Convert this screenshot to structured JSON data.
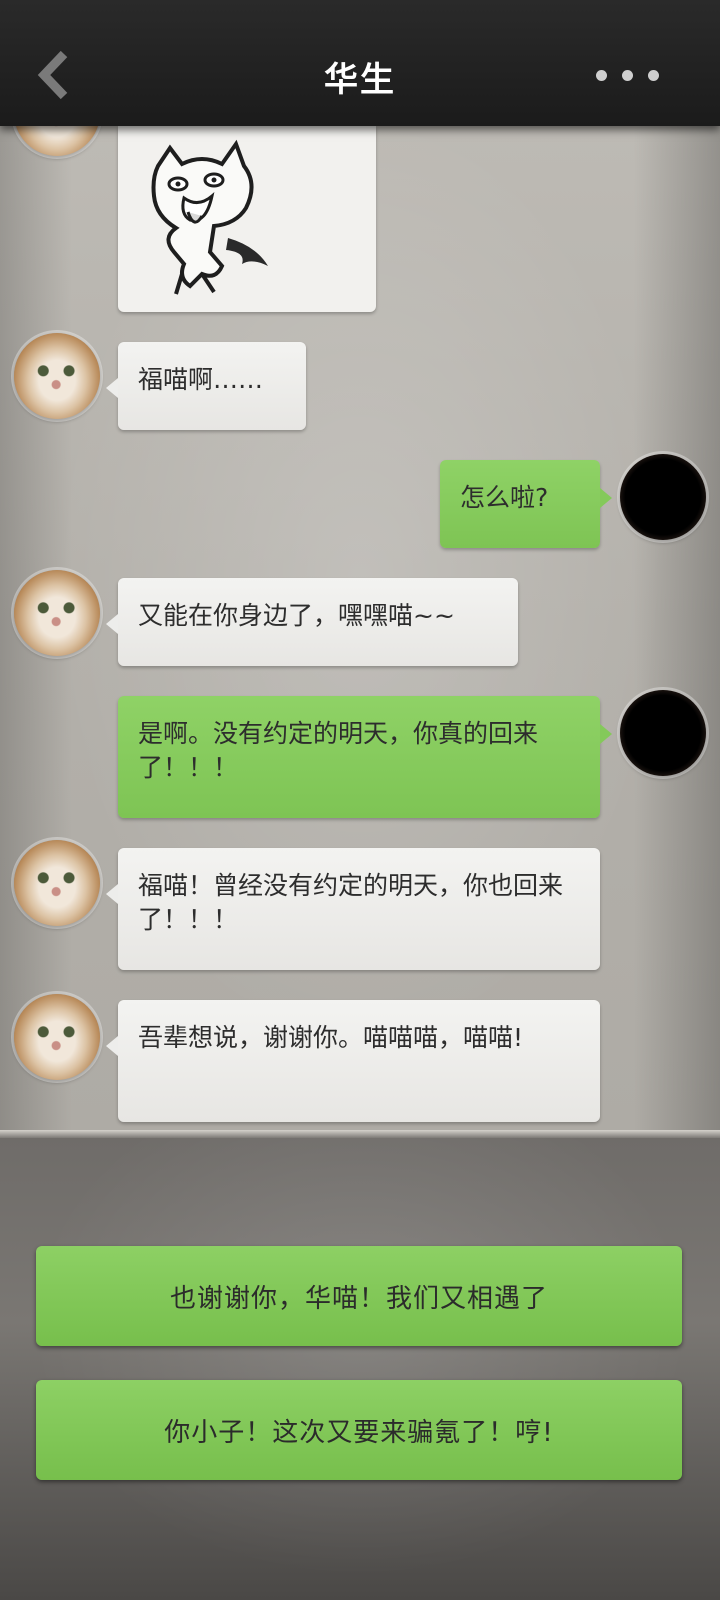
{
  "header": {
    "title": "华生",
    "back_icon": "chevron-left-icon",
    "more_icon": "more-dots-icon"
  },
  "messages": [
    {
      "side": "in",
      "type": "sticker",
      "sticker": "cartoon-creature-sticker"
    },
    {
      "side": "in",
      "text": "福喵啊……"
    },
    {
      "side": "out",
      "text": "怎么啦?"
    },
    {
      "side": "in",
      "text": "又能在你身边了，嘿嘿喵~~"
    },
    {
      "side": "out",
      "text": "是啊。没有约定的明天，你真的回来了！！！"
    },
    {
      "side": "in",
      "text": "福喵！曾经没有约定的明天，你也回来了！！！"
    },
    {
      "side": "in",
      "text": "吾辈想说，谢谢你。喵喵喵，喵喵!"
    }
  ],
  "replies": [
    {
      "label": "也谢谢你，华喵！我们又相遇了"
    },
    {
      "label": "你小子！这次又要来骗氪了！哼!"
    }
  ],
  "colors": {
    "header_bg": "#1f1f1f",
    "incoming_bubble": "#ededeb",
    "outgoing_bubble": "#84c95a",
    "reply_button": "#82c858"
  }
}
